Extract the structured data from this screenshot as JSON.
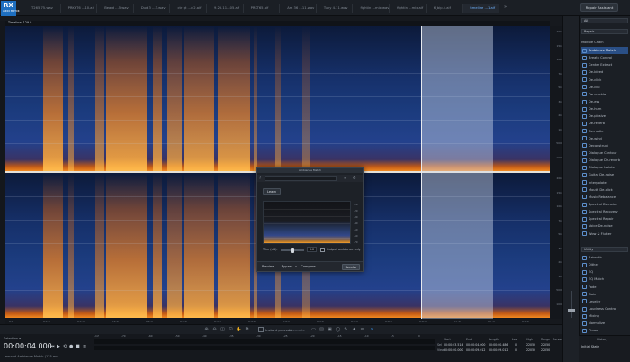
{
  "app": {
    "logo": "RX",
    "logo_sub": "AUDIO EDITOR"
  },
  "tabs": [
    {
      "label": "T265.75.wav",
      "active": false
    },
    {
      "label": "PRK6T6 ...10.aif",
      "active": false
    },
    {
      "label": "Beard ...5.wav",
      "active": false
    },
    {
      "label": "Dud 3 ...3.wav",
      "active": false
    },
    {
      "label": "ctr gt ...c.2.aif",
      "active": false
    },
    {
      "label": "9.25.11...05.aif",
      "active": false
    },
    {
      "label": "PRKT65.aif",
      "active": false
    },
    {
      "label": "Am 36 ...11.wav",
      "active": false
    },
    {
      "label": "Tuny 4.11.wav",
      "active": false
    },
    {
      "label": "fightin ...mix.wav",
      "active": false
    },
    {
      "label": "fightin ...mix.aif",
      "active": false
    },
    {
      "label": "6_bip.4.aif",
      "active": false
    },
    {
      "label": "timeline ...1.aif",
      "active": true
    }
  ],
  "header": {
    "repair_assistant": "Repair Assistant",
    "more": "»"
  },
  "timeline_label": "Timeline: 129.0",
  "freq_ticks": [
    "20k",
    "15k",
    "10k",
    "7k",
    "5k",
    "3k",
    "2k",
    "1k",
    "500",
    "100",
    "20k",
    "15k",
    "10k",
    "7k",
    "5k",
    "3k",
    "2k",
    "1k",
    "500",
    "100"
  ],
  "time_ticks": [
    "0:0",
    "0:1.0",
    "0:1.5",
    "0:2.0",
    "0:2.5",
    "0:3.0",
    "0:3.5",
    "0:4.0",
    "0:4.5",
    "0:5.0",
    "0:5.5",
    "0:6.0",
    "0:6.5",
    "0:7.0",
    "0:7.5",
    "0:8.0"
  ],
  "toolbar": {
    "instant_process": "Instant process",
    "attenuate": "Attenuate"
  },
  "transport": {
    "selection_caption": "Selection ▾",
    "timecode": "00:00:04.000",
    "status": "Learned Ambience Match (125 ms)",
    "meter_scale": [
      "-Inf",
      "-70",
      "-60",
      "-50",
      "-40",
      "-35",
      "-30",
      "-25",
      "-20",
      "-15",
      "-10",
      "-5",
      "0"
    ]
  },
  "selection_info": {
    "start_label": "Start",
    "end_label": "End",
    "length_label": "Length",
    "low_label": "Low",
    "high_label": "High",
    "range_label": "Range",
    "cursor_label": "Cursor",
    "sel_label": "Sel",
    "view_label": "View",
    "sel_start": "00:00:03.514",
    "sel_end": "00:00:04.000",
    "sel_length": "00:00:00.486",
    "view_start": "00:00:00.000",
    "view_end": "00:00:09.012",
    "view_length": "00:00:09.012",
    "sel_low": "0",
    "sel_high": "22050",
    "sel_range": "22050",
    "view_low": "0",
    "view_high": "22050",
    "view_range": "22050"
  },
  "module_panel": {
    "category": "All",
    "presets": "Repair",
    "chain_header": "Module Chain",
    "repair_modules": [
      "Ambience Match",
      "Breath Control",
      "Center Extract",
      "De-bleed",
      "De-click",
      "De-clip",
      "De-crackle",
      "De-ess",
      "De-hum",
      "De-plosive",
      "De-reverb",
      "De-rustle",
      "De-wind",
      "Deconstruct",
      "Dialogue Contour",
      "Dialogue De-reverb",
      "Dialogue Isolate",
      "Guitar De-noise",
      "Interpolate",
      "Mouth De-click",
      "Music Rebalance",
      "Spectral De-noise",
      "Spectral Recovery",
      "Spectral Repair",
      "Voice De-noise",
      "Wow & Flutter"
    ],
    "selected_module": "Ambience Match",
    "utility_header": "Utility",
    "utility_modules": [
      "Azimuth",
      "Dither",
      "EQ",
      "EQ Match",
      "Fade",
      "Gain",
      "Leveler",
      "Loudness Control",
      "Mixing",
      "Normalize",
      "Phase",
      "Plug-in"
    ]
  },
  "history": {
    "title": "History",
    "item": "Initial State"
  },
  "dialog": {
    "title": "Ambience Match",
    "learn": "Learn",
    "trim_label": "Trim (dB):",
    "trim_value": "0.0",
    "trim_fraction": 0.5,
    "output_ambience_only": "Output ambience only",
    "graph_scale": [
      "-10",
      "-20",
      "-30",
      "-40",
      "-50",
      "-60",
      "-70"
    ],
    "preview": "Preview",
    "bypass": "Bypass",
    "compare": "Compare",
    "render": "Render"
  }
}
